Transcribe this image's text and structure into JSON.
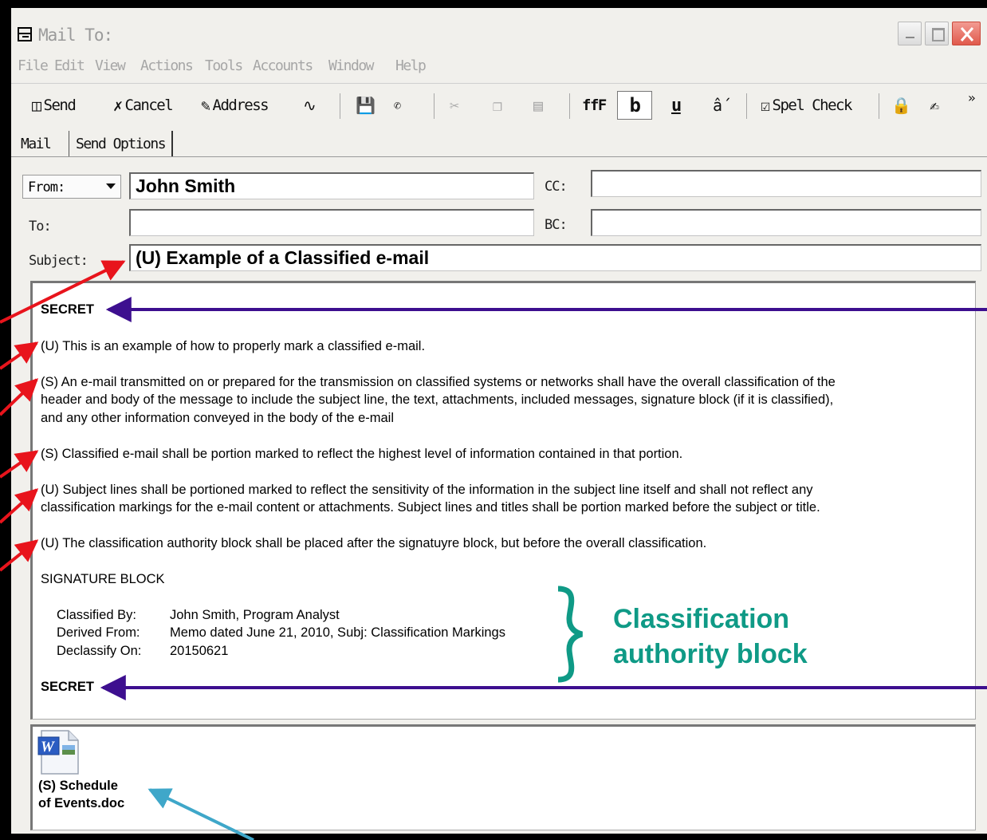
{
  "window": {
    "title": "Mail To:"
  },
  "menu": [
    "File",
    "Edit",
    "View",
    "Actions",
    "Tools",
    "Accounts",
    "Window",
    "Help"
  ],
  "toolbar": {
    "send": "Send",
    "cancel": "Cancel",
    "address": "Address",
    "font": "ffF",
    "bold": "b",
    "underline": "u",
    "spellcheck": "Spel Check",
    "more": "»"
  },
  "tabs": {
    "mail": "Mail",
    "send_options": "Send Options"
  },
  "form": {
    "from_label": "From:",
    "from_value": "John Smith",
    "to_label": "To:",
    "to_value": "",
    "subject_label": "Subject:",
    "subject_value": "(U) Example of a Classified e-mail",
    "cc_label": "CC:",
    "cc_value": "",
    "bc_label": "BC:",
    "bc_value": ""
  },
  "body": {
    "banner_top": "SECRET",
    "p1": "(U) This is an example of how to properly mark a classified e-mail.",
    "p2_l1": "(S) An e-mail transmitted on or prepared for the transmission on classified systems or networks shall have the overall classification of the",
    "p2_l2": "header and body of the message to include the subject line, the text, attachments, included messages, signature block (if it is classified),",
    "p2_l3": "and any other information conveyed in the body of the e-mail",
    "p3": "(S) Classified e-mail shall be portion marked to reflect the highest level of information contained in that portion.",
    "p4_l1": "(U) Subject lines shall be portioned marked to reflect the sensitivity of the information in the subject line itself and shall not reflect any",
    "p4_l2": "classification markings for the e-mail content or attachments.  Subject lines and titles shall be portion marked before the subject or title.",
    "p5": "(U) The classification authority block shall be placed after the signatuyre block, but before the overall classification.",
    "signature": "SIGNATURE BLOCK",
    "classified_by_label": "Classified By:",
    "classified_by_value": "John Smith, Program Analyst",
    "derived_from_label": "Derived From:",
    "derived_from_value": "Memo dated June 21, 2010, Subj:  Classification Markings",
    "declassify_on_label": "Declassify On:",
    "declassify_on_value": "20150621",
    "banner_bottom": "SECRET"
  },
  "annotation": {
    "line1": "Classification",
    "line2": "authority block"
  },
  "attachment": {
    "line1": "(S) Schedule",
    "line2": "of Events.doc"
  },
  "colors": {
    "red_arrow": "#e8141c",
    "purple_arrow": "#3d0f8f",
    "blue_arrow": "#3fa7c9",
    "teal_text": "#0f9a86"
  }
}
